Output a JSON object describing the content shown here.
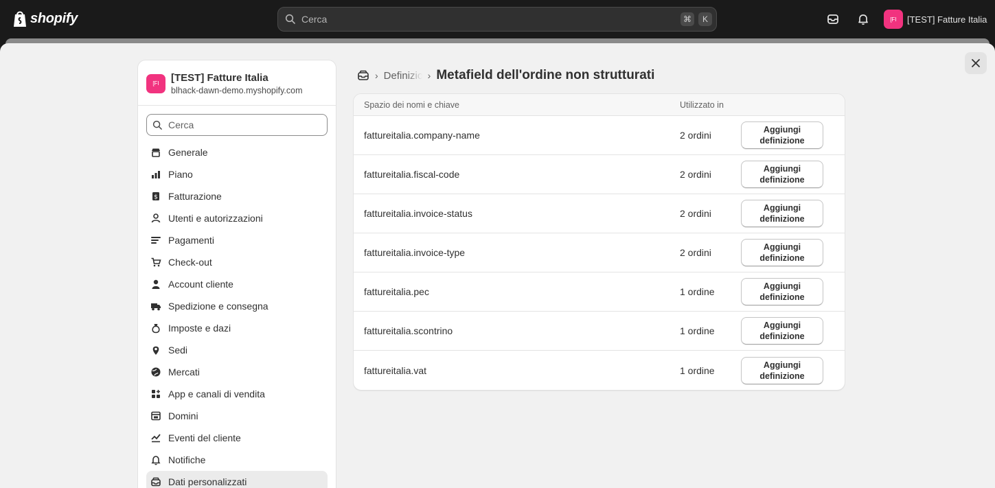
{
  "topbar": {
    "brand": "shopify",
    "search_placeholder": "Cerca",
    "shortcut_keys": [
      "⌘",
      "K"
    ],
    "store_avatar": "[FI",
    "store_name": "[TEST] Fatture Italia"
  },
  "sidebar": {
    "shop_avatar": "[FI",
    "shop_name": "[TEST] Fatture Italia",
    "shop_domain": "blhack-dawn-demo.myshopify.com",
    "search_placeholder": "Cerca",
    "items": [
      {
        "label": "Generale",
        "icon": "store-icon"
      },
      {
        "label": "Piano",
        "icon": "plan-chart-icon"
      },
      {
        "label": "Fatturazione",
        "icon": "billing-icon"
      },
      {
        "label": "Utenti e autorizzazioni",
        "icon": "users-icon"
      },
      {
        "label": "Pagamenti",
        "icon": "payments-icon"
      },
      {
        "label": "Check-out",
        "icon": "cart-icon"
      },
      {
        "label": "Account cliente",
        "icon": "person-icon"
      },
      {
        "label": "Spedizione e consegna",
        "icon": "truck-icon"
      },
      {
        "label": "Imposte e dazi",
        "icon": "money-bag-icon"
      },
      {
        "label": "Sedi",
        "icon": "location-pin-icon"
      },
      {
        "label": "Mercati",
        "icon": "globe-icon"
      },
      {
        "label": "App e canali di vendita",
        "icon": "apps-icon"
      },
      {
        "label": "Domini",
        "icon": "domain-icon"
      },
      {
        "label": "Eventi del cliente",
        "icon": "events-icon"
      },
      {
        "label": "Notifiche",
        "icon": "bell-icon"
      },
      {
        "label": "Dati personalizzati",
        "icon": "database-icon",
        "active": true
      }
    ]
  },
  "breadcrumb": {
    "link": "Definizioni",
    "title": "Metafield dell'ordine non strutturati"
  },
  "table": {
    "headers": [
      "Spazio dei nomi e chiave",
      "Utilizzato in"
    ],
    "action_label": "Aggiungi definizione",
    "rows": [
      {
        "key": "fattureitalia.company-name",
        "used": "2 ordini"
      },
      {
        "key": "fattureitalia.fiscal-code",
        "used": "2 ordini"
      },
      {
        "key": "fattureitalia.invoice-status",
        "used": "2 ordini"
      },
      {
        "key": "fattureitalia.invoice-type",
        "used": "2 ordini"
      },
      {
        "key": "fattureitalia.pec",
        "used": "1 ordine"
      },
      {
        "key": "fattureitalia.scontrino",
        "used": "1 ordine"
      },
      {
        "key": "fattureitalia.vat",
        "used": "1 ordine"
      }
    ]
  },
  "colors": {
    "topbar_bg": "#1a1a1a",
    "modal_bg": "#f1f1f1",
    "avatar_pink": "#f1337f"
  }
}
